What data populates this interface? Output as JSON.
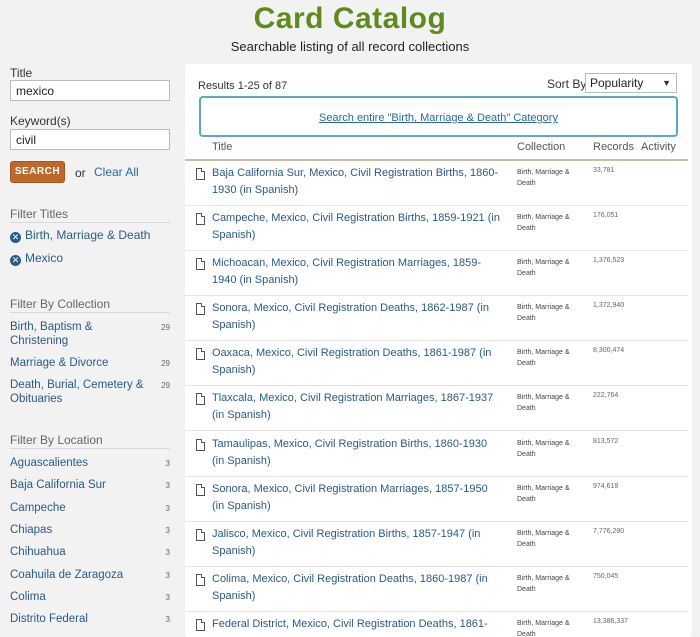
{
  "header": {
    "title": "Card Catalog",
    "subtitle": "Searchable listing of all record collections"
  },
  "sidebar": {
    "title_label": "Title",
    "title_value": "mexico",
    "keyword_label": "Keyword(s)",
    "keyword_value": "civil",
    "search_button": "SEARCH",
    "or_text": "or",
    "clear_all": "Clear All",
    "filter_titles_heading": "Filter Titles",
    "active_filters": [
      "Birth, Marriage & Death",
      "Mexico"
    ],
    "filter_collection_heading": "Filter By Collection",
    "collections": [
      {
        "name": "Birth, Baptism & Christening",
        "count": "29"
      },
      {
        "name": "Marriage & Divorce",
        "count": "29"
      },
      {
        "name": "Death, Burial, Cemetery & Obituaries",
        "count": "29"
      }
    ],
    "filter_location_heading": "Filter By Location",
    "locations": [
      {
        "name": "Aguascalientes",
        "count": "3"
      },
      {
        "name": "Baja California Sur",
        "count": "3"
      },
      {
        "name": "Campeche",
        "count": "3"
      },
      {
        "name": "Chiapas",
        "count": "3"
      },
      {
        "name": "Chihuahua",
        "count": "3"
      },
      {
        "name": "Coahuila de Zaragoza",
        "count": "3"
      },
      {
        "name": "Colima",
        "count": "3"
      },
      {
        "name": "Distrito Federal",
        "count": "3"
      }
    ]
  },
  "main": {
    "results_count": "Results 1-25 of 87",
    "sort_label": "Sort By",
    "sort_value": "Popularity",
    "search_category_link": "Search entire \"Birth, Marriage & Death\" Category",
    "columns": [
      "Title",
      "Collection",
      "Records",
      "Activity"
    ],
    "rows": [
      {
        "title": "Baja California Sur, Mexico, Civil Registration Births, 1860-1930 (in Spanish)",
        "collection": "Birth, Marriage & Death",
        "records": "33,781"
      },
      {
        "title": "Campeche, Mexico, Civil Registration Births, 1859-1921 (in Spanish)",
        "collection": "Birth, Marriage & Death",
        "records": "176,051"
      },
      {
        "title": "Michoacan, Mexico, Civil Registration Marriages, 1859-1940 (in Spanish)",
        "collection": "Birth, Marriage & Death",
        "records": "1,376,523"
      },
      {
        "title": "Sonora, Mexico, Civil Registration Deaths, 1862-1987 (in Spanish)",
        "collection": "Birth, Marriage & Death",
        "records": "1,372,940"
      },
      {
        "title": "Oaxaca, Mexico, Civil Registration Deaths, 1861-1987 (in Spanish)",
        "collection": "Birth, Marriage & Death",
        "records": "8,300,474"
      },
      {
        "title": "Tlaxcala, Mexico, Civil Registration Marriages, 1867-1937 (in Spanish)",
        "collection": "Birth, Marriage & Death",
        "records": "222,764"
      },
      {
        "title": "Tamaulipas, Mexico, Civil Registration Births, 1860-1930 (in Spanish)",
        "collection": "Birth, Marriage & Death",
        "records": "813,572"
      },
      {
        "title": "Sonora, Mexico, Civil Registration Marriages, 1857-1950 (in Spanish)",
        "collection": "Birth, Marriage & Death",
        "records": "974,619"
      },
      {
        "title": "Jalisco, Mexico, Civil Registration Births, 1857-1947 (in Spanish)",
        "collection": "Birth, Marriage & Death",
        "records": "7,776,280"
      },
      {
        "title": "Colima, Mexico, Civil Registration Deaths, 1860-1987 (in Spanish)",
        "collection": "Birth, Marriage & Death",
        "records": "750,045"
      },
      {
        "title": "Federal District, Mexico, Civil Registration Deaths, 1861-",
        "collection": "Birth, Marriage & Death",
        "records": "13,386,337"
      }
    ]
  }
}
